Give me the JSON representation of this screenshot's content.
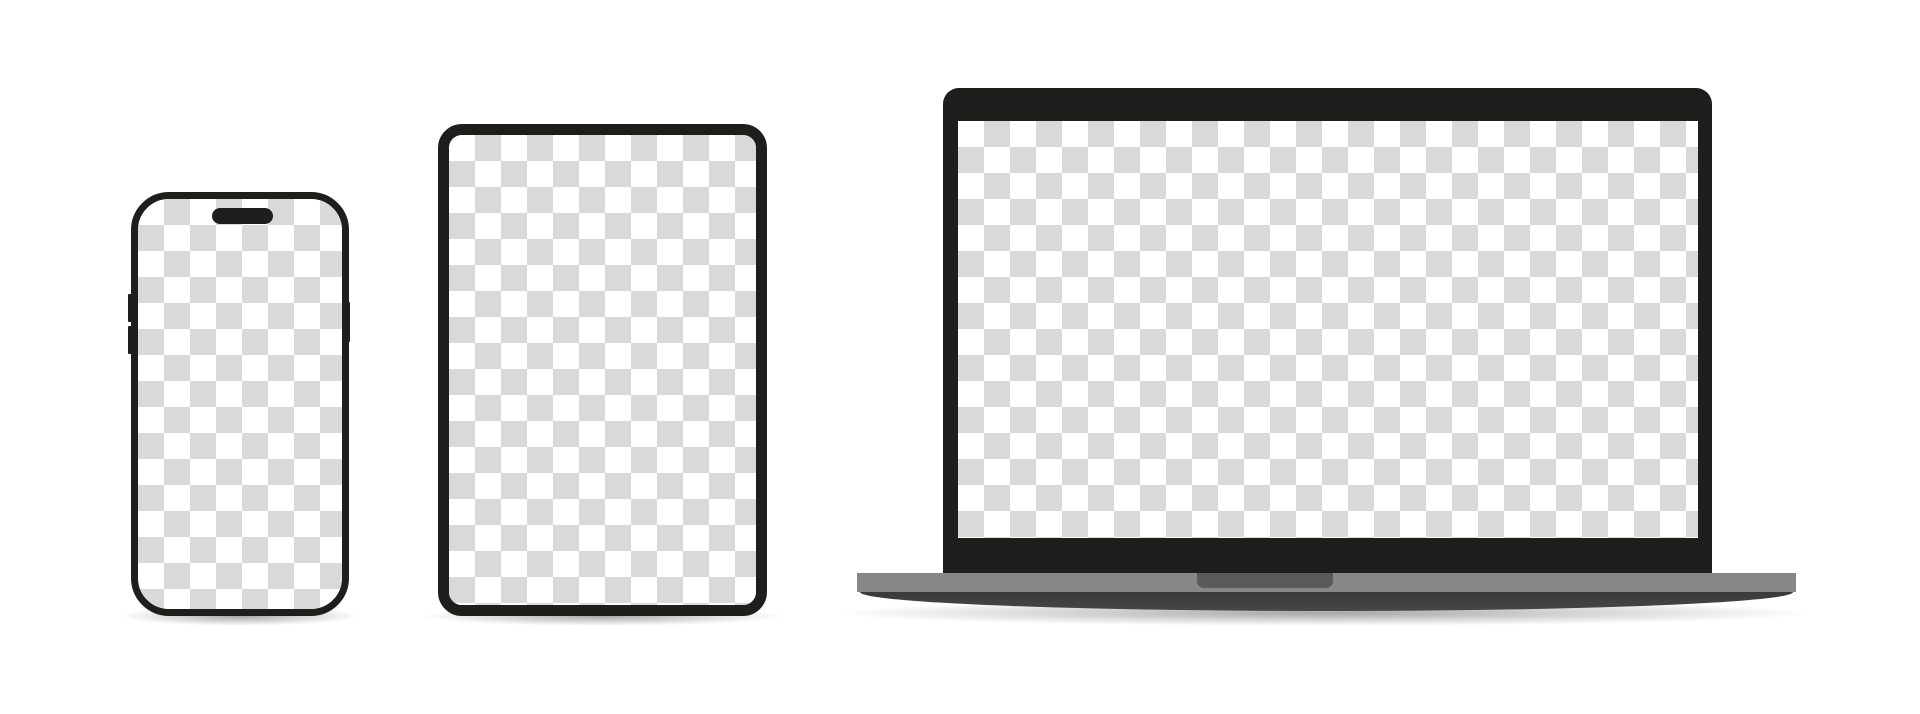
{
  "devices": [
    {
      "type": "phone"
    },
    {
      "type": "tablet"
    },
    {
      "type": "laptop"
    }
  ],
  "colors": {
    "bezel": "#1e1e1c",
    "checker_light": "#ffffff",
    "checker_dark": "#d9d9d9",
    "laptop_base": "#878787",
    "laptop_bottom": "#3f3f3f",
    "laptop_notch": "#5a5a5a"
  }
}
